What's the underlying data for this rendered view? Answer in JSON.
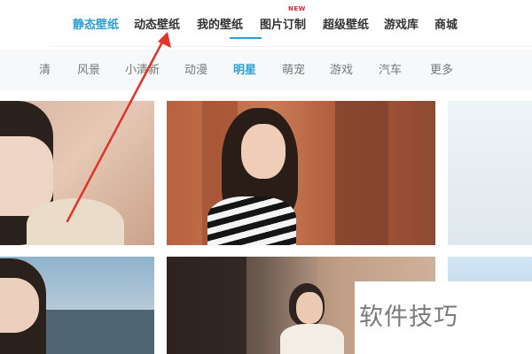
{
  "top_nav": {
    "items": [
      {
        "label": "静态壁纸",
        "active": true
      },
      {
        "label": "动态壁纸",
        "active": false
      },
      {
        "label": "我的壁纸",
        "active": false
      },
      {
        "label": "图片订制",
        "active": false,
        "badge": "NEW"
      },
      {
        "label": "超级壁纸",
        "active": false
      },
      {
        "label": "游戏库",
        "active": false
      },
      {
        "label": "商城",
        "active": false
      }
    ]
  },
  "categories": {
    "items": [
      "清",
      "风景",
      "小清新",
      "动漫",
      "明星",
      "萌宠",
      "游戏",
      "汽车",
      "更多"
    ],
    "active": "明星"
  },
  "wallpapers": {
    "tiles": [
      {
        "subject": "woman-portrait-beige"
      },
      {
        "subject": "woman-striped-sweater-brick-wall"
      },
      {
        "subject": "light-blue-abstract"
      },
      {
        "subject": "woman-profile-blue-sky"
      },
      {
        "subject": "man-white-sweater-street"
      },
      {
        "subject": "light-blue-abstract-2"
      }
    ]
  },
  "annotation": {
    "arrow_color": "#e0342a",
    "points_to": "动态壁纸"
  },
  "watermark": {
    "text": "软件技巧"
  },
  "colors": {
    "accent": "#2a9fd6",
    "new_badge": "#e0233a",
    "arrow": "#e0342a"
  }
}
